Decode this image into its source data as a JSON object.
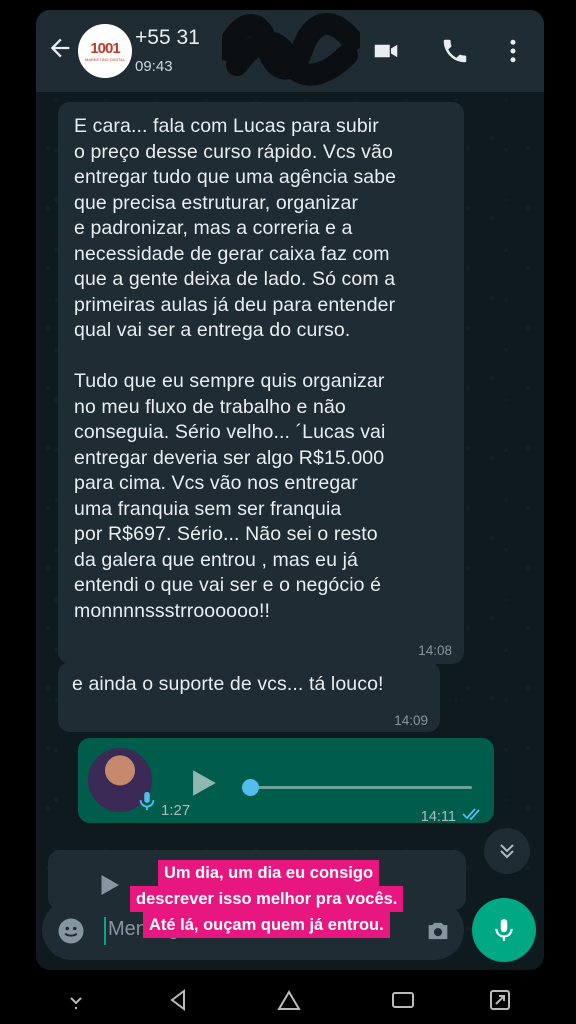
{
  "header": {
    "contact_name": "+55 31 ",
    "contact_subtitle": "09:43",
    "logo_text": "1001",
    "logo_subtext": "MARKETING DIGITAL",
    "icons": [
      "back-arrow-icon",
      "video-call-icon",
      "phone-icon",
      "more-vertical-icon"
    ]
  },
  "messages": [
    {
      "direction": "incoming",
      "text": "E cara... fala com Lucas para subir\no preço desse curso rápido. Vcs vão\nentregar tudo que uma agência sabe\nque precisa estruturar, organizar\ne padronizar, mas a correria e a\nnecessidade de gerar caixa faz com\nque a gente deixa de lado. Só com a\nprimeiras aulas já deu para entender\nqual vai ser a entrega do curso.\n\nTudo que eu sempre quis organizar\nno meu fluxo de trabalho e não\nconseguia. Sério velho... ´Lucas vai\nentregar deveria ser algo R$15.000\npara cima. Vcs vão nos entregar\numa franquia sem ser franquia\npor R$697. Sério... Não sei o resto\nda galera que entrou , mas eu já\nentendi o que vai ser e o negócio é\nmonnnnssstrroooooo!!",
      "time": "14:08"
    },
    {
      "direction": "incoming",
      "text": "e ainda o suporte de vcs... tá louco!",
      "time": "14:09"
    },
    {
      "direction": "outgoing",
      "type": "voice",
      "duration": "1:27",
      "time": "14:11",
      "progress": 0.0,
      "read": true
    }
  ],
  "composer": {
    "placeholder": "Mensagem"
  },
  "overlay_caption": [
    "Um dia, um dia eu consigo",
    "descrever isso melhor pra vocês.",
    "Até lá, ouçam quem já entrou."
  ],
  "colors": {
    "header_bg": "#1f2c33",
    "incoming_bubble": "#202c33",
    "outgoing_bubble": "#005c4b",
    "accent": "#00a884",
    "caption_bg": "#e8177f",
    "read_ticks": "#53bdeb"
  }
}
